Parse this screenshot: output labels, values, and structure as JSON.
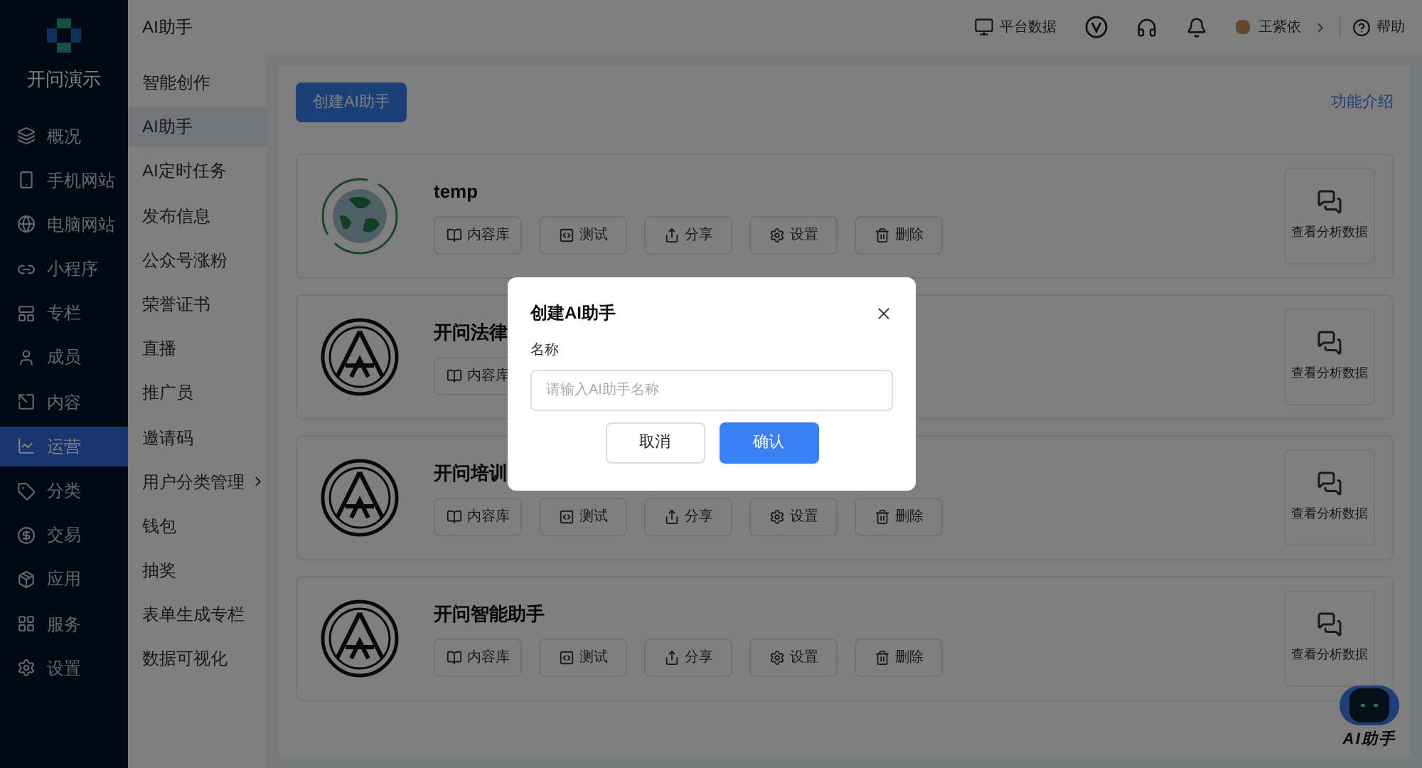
{
  "brand": {
    "name": "开问演示"
  },
  "nav": [
    {
      "label": "概况",
      "selected": false
    },
    {
      "label": "手机网站",
      "selected": false
    },
    {
      "label": "电脑网站",
      "selected": false
    },
    {
      "label": "小程序",
      "selected": false
    },
    {
      "label": "专栏",
      "selected": false
    },
    {
      "label": "成员",
      "selected": false
    },
    {
      "label": "内容",
      "selected": false
    },
    {
      "label": "运营",
      "selected": true
    },
    {
      "label": "分类",
      "selected": false
    },
    {
      "label": "交易",
      "selected": false
    },
    {
      "label": "应用",
      "selected": false
    },
    {
      "label": "服务",
      "selected": false
    },
    {
      "label": "设置",
      "selected": false
    }
  ],
  "submenu": [
    {
      "label": "智能创作",
      "selected": false,
      "has_children": false
    },
    {
      "label": "AI助手",
      "selected": true,
      "has_children": false
    },
    {
      "label": "AI定时任务",
      "selected": false,
      "has_children": false
    },
    {
      "label": "发布信息",
      "selected": false,
      "has_children": false
    },
    {
      "label": "公众号涨粉",
      "selected": false,
      "has_children": false
    },
    {
      "label": "荣誉证书",
      "selected": false,
      "has_children": false
    },
    {
      "label": "直播",
      "selected": false,
      "has_children": false
    },
    {
      "label": "推广员",
      "selected": false,
      "has_children": false
    },
    {
      "label": "邀请码",
      "selected": false,
      "has_children": false
    },
    {
      "label": "用户分类管理",
      "selected": false,
      "has_children": true
    },
    {
      "label": "钱包",
      "selected": false,
      "has_children": false
    },
    {
      "label": "抽奖",
      "selected": false,
      "has_children": false
    },
    {
      "label": "表单生成专栏",
      "selected": false,
      "has_children": false
    },
    {
      "label": "数据可视化",
      "selected": false,
      "has_children": false
    }
  ],
  "header": {
    "title": "AI助手",
    "platform_data": "平台数据",
    "user": "王紫依",
    "help": "帮助"
  },
  "toolbar": {
    "create_button": "创建AI助手",
    "intro_link": "功能介绍"
  },
  "assistants": [
    {
      "name": "temp",
      "kind": "globe",
      "actions": [
        "内容库",
        "测试",
        "分享",
        "设置",
        "删除"
      ],
      "analytics": "查看分析数据"
    },
    {
      "name": "开问法律",
      "kind": "emblem",
      "actions": [
        "内容库"
      ],
      "analytics": "查看分析数据"
    },
    {
      "name": "开问培训",
      "kind": "emblem",
      "actions": [
        "内容库",
        "测试",
        "分享",
        "设置",
        "删除"
      ],
      "analytics": "查看分析数据"
    },
    {
      "name": "开问智能助手",
      "kind": "emblem",
      "actions": [
        "内容库",
        "测试",
        "分享",
        "设置",
        "删除"
      ],
      "analytics": "查看分析数据"
    }
  ],
  "floating_assistant": {
    "label": "AI助手"
  },
  "dialog": {
    "title": "创建AI助手",
    "field_label": "名称",
    "placeholder": "请输入AI助手名称",
    "cancel": "取消",
    "confirm": "确认"
  }
}
